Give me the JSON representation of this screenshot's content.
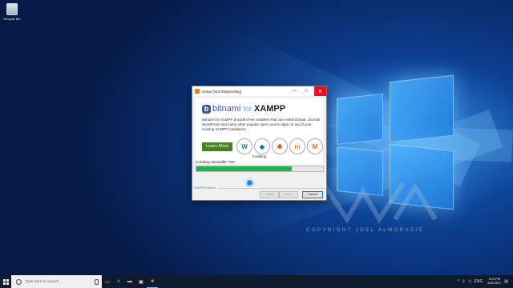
{
  "desktop": {
    "icons": [
      {
        "label": "Recycle Bin",
        "icon": "recycle-bin-icon"
      }
    ],
    "watermark": "COPYRIGHT JOEL ALMORADIE"
  },
  "window": {
    "title": "Setup (Not Responding)",
    "controls": {
      "minimize": "—",
      "maximize": "□",
      "close": "✕"
    },
    "banner": {
      "brand": "bitnami",
      "for": "for",
      "product": "XAMPP",
      "description": "Bitnami for XAMPP provides free installers that can install Drupal, Joomla!, WordPress and many other popular open source apps on top of your existing XAMPP installation.",
      "learn_more": "Learn More",
      "apps": [
        {
          "name": "WordPress",
          "glyph": "W",
          "color": "#21759b"
        },
        {
          "name": "Drupal",
          "glyph": "◆",
          "color": "#0077c0"
        },
        {
          "name": "Joomla",
          "glyph": "✱",
          "color": "#f44321"
        },
        {
          "name": "Moodle",
          "glyph": "m",
          "color": "#f98012"
        },
        {
          "name": "Magento",
          "glyph": "M",
          "color": "#ee672f"
        }
      ]
    },
    "section_title": "Installing",
    "status": "Creating uninstaller 75%",
    "progress": 0.75,
    "footer_label": "XAMPP Installer",
    "buttons": {
      "back": "< Back",
      "next": "Next >",
      "cancel": "Cancel"
    }
  },
  "taskbar": {
    "search_placeholder": "Type here to search",
    "apps": [
      "task-view-icon",
      "edge-icon",
      "file-explorer-icon",
      "store-icon",
      "xampp-icon"
    ],
    "tray": {
      "up": "^",
      "lang": "ENG",
      "time": "5:23 PM",
      "date": "5/31/2017"
    }
  }
}
